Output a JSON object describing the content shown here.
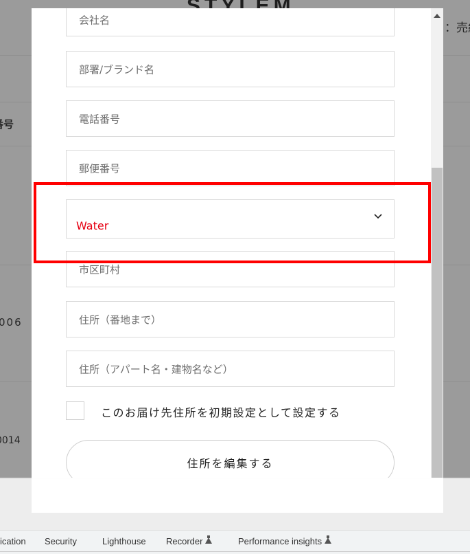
{
  "background": {
    "site_title": "STYLEM",
    "right_text": "：売約",
    "table_header": "番号",
    "rows": [
      "006",
      "0014"
    ]
  },
  "modal": {
    "fields": [
      {
        "name": "company-name",
        "placeholder": "会社名"
      },
      {
        "name": "department-brand",
        "placeholder": "部署/ブランド名"
      },
      {
        "name": "phone-number",
        "placeholder": "電話番号"
      },
      {
        "name": "postal-code",
        "placeholder": "郵便番号"
      },
      {
        "name": "city",
        "placeholder": "市区町村"
      },
      {
        "name": "address-street",
        "placeholder": "住所（番地まで）"
      },
      {
        "name": "address-building",
        "placeholder": "住所（アパート名・建物名など）"
      }
    ],
    "prefecture_select": {
      "value": "Water",
      "value_color": "#e60012",
      "icon": "chevron-down-icon"
    },
    "default_checkbox": {
      "label": "このお届け先住所を初期設定として設定する",
      "checked": false
    },
    "edit_button": {
      "label": "住所を編集する"
    }
  },
  "highlight": {
    "color": "#ff0000",
    "target": "prefecture-select"
  },
  "devtools": {
    "tabs": [
      {
        "label": "ication",
        "experimental": false
      },
      {
        "label": "Security",
        "experimental": false
      },
      {
        "label": "Lighthouse",
        "experimental": false
      },
      {
        "label": "Recorder",
        "experimental": true
      },
      {
        "label": "Performance insights",
        "experimental": true
      }
    ]
  }
}
